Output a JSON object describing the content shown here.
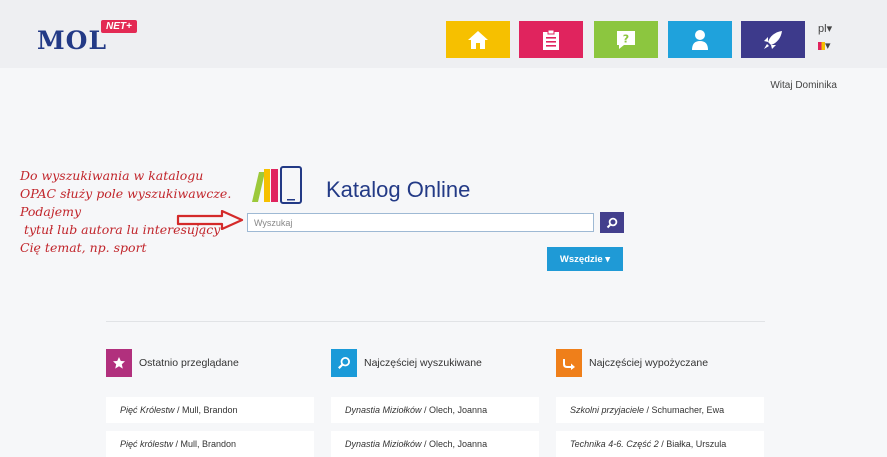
{
  "header": {
    "logo_text": "MOL",
    "logo_badge": "NET+",
    "nav": [
      {
        "icon": "home-icon",
        "color": "#f6c000"
      },
      {
        "icon": "clipboard-icon",
        "color": "#e0245e"
      },
      {
        "icon": "help-icon",
        "color": "#8cc63f"
      },
      {
        "icon": "user-icon",
        "color": "#1fa2dc"
      },
      {
        "icon": "rocket-icon",
        "color": "#3d3a8b"
      }
    ],
    "language": "pl",
    "language_arrow": "▾",
    "theme_arrow": "▾"
  },
  "welcome": "Witaj Dominika",
  "annotation": {
    "lines": [
      "Do wyszukiwania w katalogu",
      "OPAC służy pole wyszukiwawcze.",
      "Podajemy",
      " tytuł lub autora lu interesujący",
      "Cię temat, np. sport"
    ],
    "color": "#c1252b"
  },
  "catalog": {
    "title": "Katalog Online",
    "search_placeholder": "Wyszukaj",
    "scope_label": "Wszędzie ▾"
  },
  "panels": [
    {
      "title": "Ostatnio przeglądane",
      "icon": "star-icon",
      "color": "#b1307d",
      "items": [
        {
          "title": "Pięć Królestw",
          "author": " / Mull, Brandon"
        },
        {
          "title": "Pięć królestw",
          "author": " / Mull, Brandon"
        }
      ]
    },
    {
      "title": "Najczęściej wyszukiwane",
      "icon": "search-icon",
      "color": "#1a9ad8",
      "items": [
        {
          "title": "Dynastia Miziołków",
          "author": " / Olech, Joanna"
        },
        {
          "title": "Dynastia Miziołków",
          "author": " / Olech, Joanna"
        }
      ]
    },
    {
      "title": "Najczęściej wypożyczane",
      "icon": "return-arrow-icon",
      "color": "#ef7f1a",
      "items": [
        {
          "title": "Szkolni przyjaciele",
          "author": " / Schumacher, Ewa"
        },
        {
          "title": "Technika 4-6. Część 2",
          "author": " / Białka, Urszula"
        }
      ]
    }
  ]
}
